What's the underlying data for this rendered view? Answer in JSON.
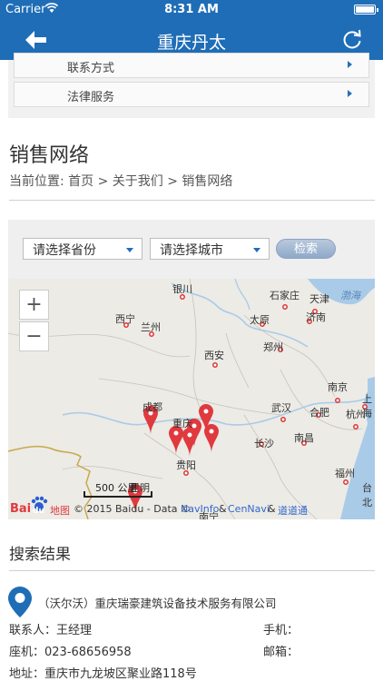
{
  "status_bar": {
    "carrier": "Carrier",
    "time": "8:31 AM"
  },
  "nav": {
    "title": "重庆丹太"
  },
  "menu": {
    "items": [
      {
        "label": "联系方式"
      },
      {
        "label": "法律服务"
      }
    ]
  },
  "page": {
    "title": "销售网络",
    "breadcrumb": "当前位置:  首页 > 关于我们 > 销售网络"
  },
  "filters": {
    "province": "请选择省份",
    "city": "请选择城市",
    "search_label": "检索"
  },
  "map": {
    "zoom_in": "+",
    "zoom_out": "−",
    "scale_label": "500 公里",
    "logo_bai": "Bai",
    "logo_du": "du",
    "logo_map": "地图",
    "copyright": "© 2015 Baidu - Data ©",
    "attr_sep1": "&",
    "attr_navinfo": "NavInfo",
    "attr_sep2": "&",
    "attr_cennavi": "CenNavi",
    "attr_sep3": "&",
    "attr_ddt": "道道通",
    "sea_label": "渤海",
    "cities": [
      {
        "name": "银川"
      },
      {
        "name": "石家庄"
      },
      {
        "name": "天津"
      },
      {
        "name": "太原"
      },
      {
        "name": "济南"
      },
      {
        "name": "西宁"
      },
      {
        "name": "兰州"
      },
      {
        "name": "郑州"
      },
      {
        "name": "西安"
      },
      {
        "name": "南京"
      },
      {
        "name": "上海"
      },
      {
        "name": "武汉"
      },
      {
        "name": "合肥"
      },
      {
        "name": "杭州"
      },
      {
        "name": "成都"
      },
      {
        "name": "重庆"
      },
      {
        "name": "长沙"
      },
      {
        "name": "南昌"
      },
      {
        "name": "贵阳"
      },
      {
        "name": "福州"
      },
      {
        "name": "台北"
      },
      {
        "name": "昆明"
      },
      {
        "name": "南宁"
      }
    ]
  },
  "results": {
    "title": "搜索结果",
    "company": "（沃尔沃）重庆瑞豪建筑设备技术服务有限公司",
    "contact_label": "联系人：",
    "contact_value": "王经理",
    "mobile_label": "手机：",
    "phone_label": "座机：",
    "phone_value": "023-68656958",
    "email_label": "邮箱：",
    "address_label": "地址：",
    "address_value": "重庆市九龙坡区聚业路118号"
  },
  "colors": {
    "nav_blue": "#1f6db7",
    "pin_red": "#e0393e"
  }
}
